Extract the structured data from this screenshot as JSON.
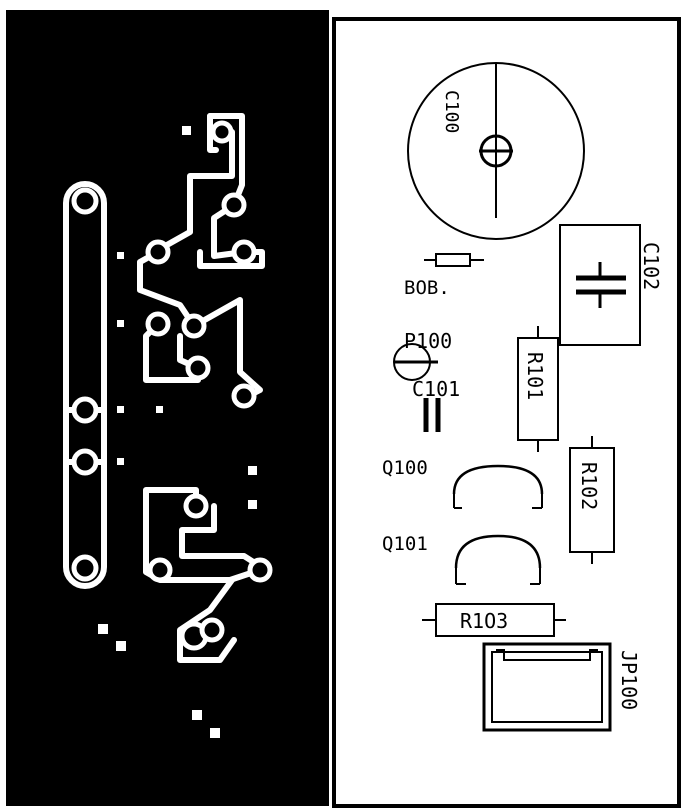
{
  "copper_layer": {
    "background_color": "#000000",
    "trace_color": "#ffffff"
  },
  "silkscreen_layer": {
    "background_color": "#ffffff",
    "line_color": "#000000",
    "components": {
      "c100": "C100",
      "c102": "C102",
      "bob": "BOB.",
      "p100": "P100",
      "c101": "C101",
      "r101": "R101",
      "r102": "R102",
      "q100": "Q100",
      "q101": "Q101",
      "r103": "R1O3",
      "jp100": "JP100"
    }
  }
}
